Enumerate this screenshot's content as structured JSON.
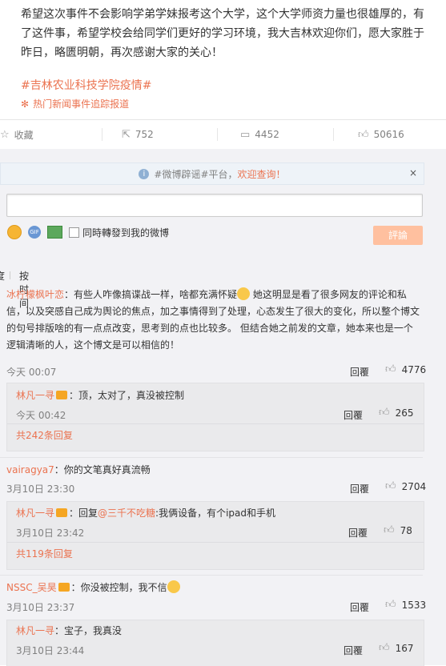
{
  "post": {
    "text": "希望这次事件不会影响学弟学妹报考这个大学，这个大学师资力量也很雄厚的，有了这件事，希望学校会给同学们更好的学习环境，我大吉林欢迎你们，愿大家胜于昨日，略匮明朝，再次感谢大家的关心！",
    "hashtag": "#吉林农业科技学院疫情#",
    "hot_link": "热门新闻事件追踪报道"
  },
  "actions": {
    "favorite_label": "收藏",
    "repost_count": "752",
    "comment_count": "4452",
    "like_count": "50616"
  },
  "notice": {
    "prefix": "#微博辟谣#平台，",
    "highlight": "欢迎查询！",
    "close": "×"
  },
  "composer": {
    "gif_label": "GIF",
    "repost_checkbox_label": "同時轉發到我的微博",
    "submit_label": "評論"
  },
  "sort": {
    "first": "度",
    "second": "按时间"
  },
  "comments": [
    {
      "user": "冰柠檬枫叶恋",
      "text": "：有些人咋像搞谍战一样，啥都充满怀疑",
      "text2": "她这明显是看了很多网友的评论和私信，以及突感自己成为舆论的焦点，加之事情得到了处理，心态发生了很大的变化，所以整个博文的句号排版啥的有一点点改变，思考到的点也比较多。 但结合她之前发的文章，她本来也是一个逻辑清晰的人，这个博文是可以相信的！",
      "time": "今天 00:07",
      "reply": "回覆",
      "likes": "4776",
      "sub": {
        "user": "林凡一寻",
        "text": "：顶，太对了，真没被控制",
        "time": "今天 00:42",
        "reply": "回覆",
        "likes": "265"
      },
      "more": "共242条回复"
    },
    {
      "user": "vairagya7",
      "text": "：你的文笔真好真流畅",
      "time": "3月10日 23:30",
      "reply": "回覆",
      "likes": "2704",
      "sub": {
        "user": "林凡一寻",
        "text_prefix": "：回复",
        "mention": "@三千不吃糖",
        "text": ":我俩设备，有个ipad和手机",
        "time": "3月10日 23:42",
        "reply": "回覆",
        "likes": "78"
      },
      "more": "共119条回复"
    },
    {
      "user": "NSSC_吴昊",
      "text": "：你没被控制，我不信",
      "time": "3月10日 23:37",
      "reply": "回覆",
      "likes": "1533",
      "sub": {
        "user": "林凡一寻",
        "text": "：宝子，我真没",
        "time": "3月10日 23:44",
        "reply": "回覆",
        "likes": "167"
      }
    }
  ]
}
